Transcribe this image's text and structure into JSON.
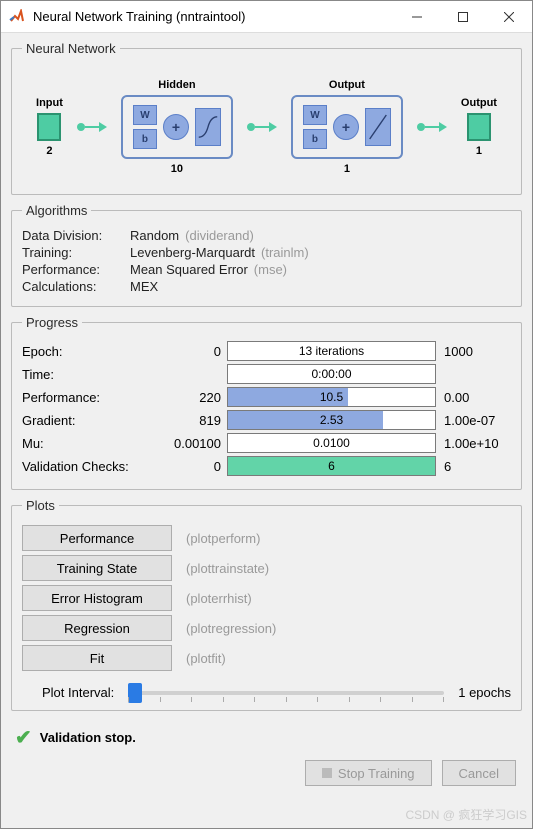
{
  "window": {
    "title": "Neural Network Training (nntraintool)"
  },
  "sections": {
    "network": "Neural Network",
    "algorithms": "Algorithms",
    "progress": "Progress",
    "plots": "Plots"
  },
  "diagram": {
    "input_label": "Input",
    "input_count": "2",
    "hidden_label": "Hidden",
    "hidden_count": "10",
    "output_label": "Output",
    "output_count": "1",
    "final_label": "Output",
    "final_count": "1",
    "w": "W",
    "b": "b",
    "plus": "+"
  },
  "algorithms": {
    "data_division": {
      "label": "Data Division:",
      "value": "Random",
      "func": "(dividerand)"
    },
    "training": {
      "label": "Training:",
      "value": "Levenberg-Marquardt",
      "func": "(trainlm)"
    },
    "performance": {
      "label": "Performance:",
      "value": "Mean Squared Error",
      "func": "(mse)"
    },
    "calculations": {
      "label": "Calculations:",
      "value": "MEX",
      "func": ""
    }
  },
  "progress": {
    "epoch": {
      "label": "Epoch:",
      "start": "0",
      "value": "13 iterations",
      "end": "1000",
      "fill_pct": 0,
      "color": "none"
    },
    "time": {
      "label": "Time:",
      "start": "",
      "value": "0:00:00",
      "end": "",
      "fill_pct": 0,
      "color": "none"
    },
    "performance": {
      "label": "Performance:",
      "start": "220",
      "value": "10.5",
      "end": "0.00",
      "fill_pct": 58,
      "color": "blue"
    },
    "gradient": {
      "label": "Gradient:",
      "start": "819",
      "value": "2.53",
      "end": "1.00e-07",
      "fill_pct": 75,
      "color": "blue"
    },
    "mu": {
      "label": "Mu:",
      "start": "0.00100",
      "value": "0.0100",
      "end": "1.00e+10",
      "fill_pct": 0,
      "color": "none"
    },
    "validation": {
      "label": "Validation Checks:",
      "start": "0",
      "value": "6",
      "end": "6",
      "fill_pct": 100,
      "color": "green"
    }
  },
  "plots": {
    "performance": {
      "label": "Performance",
      "func": "(plotperform)"
    },
    "trainstate": {
      "label": "Training State",
      "func": "(plottrainstate)"
    },
    "errhist": {
      "label": "Error Histogram",
      "func": "(ploterrhist)"
    },
    "regression": {
      "label": "Regression",
      "func": "(plotregression)"
    },
    "fit": {
      "label": "Fit",
      "func": "(plotfit)"
    },
    "interval_label": "Plot Interval:",
    "interval_value": "1 epochs"
  },
  "status": {
    "text": "Validation stop."
  },
  "buttons": {
    "stop": "Stop Training",
    "cancel": "Cancel"
  },
  "watermark": "CSDN @ 疯狂学习GIS"
}
